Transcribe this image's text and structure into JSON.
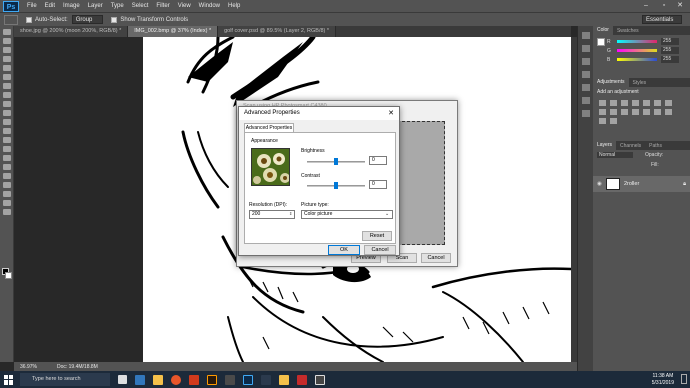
{
  "app": {
    "logo": "Ps",
    "menu": [
      "File",
      "Edit",
      "Image",
      "Layer",
      "Type",
      "Select",
      "Filter",
      "View",
      "Window",
      "Help"
    ]
  },
  "options": {
    "auto_select_label": "Auto-Select:",
    "auto_select_value": "Group",
    "transform_label": "Show Transform Controls",
    "workspace": "Essentials"
  },
  "tabs": [
    {
      "label": "shoe.jpg @ 200% (moon 200%, RGB/8) *"
    },
    {
      "label": "IMG_002.bmp @ 37% (Index) *"
    },
    {
      "label": "golf cover.psd @ 89.5% (Layer 2, RGB/8) *"
    }
  ],
  "status": {
    "zoom": "36.97%",
    "doc": "Doc: 19.4M/18.8M"
  },
  "panels": {
    "color_tabs": [
      "Color",
      "Swatches"
    ],
    "rgb": [
      {
        "ch": "R",
        "val": "255"
      },
      {
        "ch": "G",
        "val": "255"
      },
      {
        "ch": "B",
        "val": "255"
      }
    ],
    "adj_tabs": [
      "Adjustments",
      "Styles"
    ],
    "adj_title": "Add an adjustment",
    "layer_tabs": [
      "Layers",
      "Channels",
      "Paths"
    ],
    "blend_mode": "Normal",
    "opacity_label": "Opacity:",
    "fill_label": "Fill:",
    "layer_name": "2roller"
  },
  "bg_dialog": {
    "title": "Scan using HP Photosmart C4380",
    "preview_btn": "Preview",
    "scan_btn": "Scan",
    "cancel_btn": "Cancel"
  },
  "adv_dialog": {
    "title": "Advanced Properties",
    "tab": "Advanced Properties",
    "appearance": "Appearance",
    "brightness_label": "Brightness",
    "brightness_value": "0",
    "brightness_level": 0.5,
    "contrast_label": "Contrast",
    "contrast_value": "0",
    "contrast_level": 0.5,
    "resolution_label": "Resolution (DPI):",
    "resolution_value": "200",
    "picture_type_label": "Picture type:",
    "picture_type_value": "Color picture",
    "reset_btn": "Reset",
    "ok_btn": "OK",
    "cancel_btn": "Cancel"
  },
  "taskbar": {
    "search_placeholder": "Type here to search",
    "time": "11:38 AM",
    "date": "5/31/2019"
  },
  "colors": {
    "ps_accent": "#3fa9f5",
    "slider_r": "#e0246a",
    "slider_g": "#dcdc1e",
    "slider_b": "#2b4bd6",
    "win_blue": "#0078d7"
  }
}
